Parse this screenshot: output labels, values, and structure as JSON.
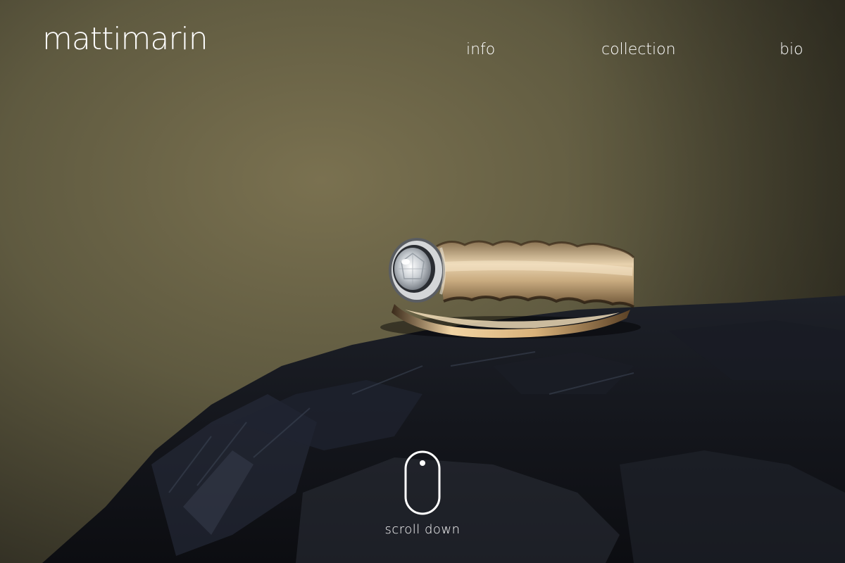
{
  "header": {
    "logo_text": "mattimarin",
    "nav": [
      {
        "label": "info"
      },
      {
        "label": "collection"
      },
      {
        "label": "bio"
      }
    ]
  },
  "hero": {
    "image": "ring-on-black-rock-photo",
    "scroll_label": "scroll down",
    "scroll_icon": "mouse-icon"
  },
  "colors": {
    "text": "#ffffff",
    "background_top": "#6e6646",
    "rock": "#14161c"
  }
}
